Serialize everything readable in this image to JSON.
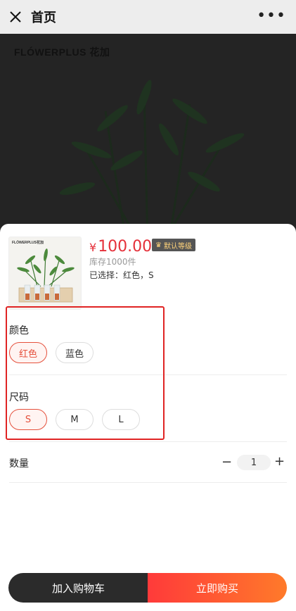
{
  "header": {
    "title": "首页",
    "more": "•••"
  },
  "hero": {
    "brand": "FLÓWERPLUS 花加"
  },
  "product": {
    "thumb_brand": "FLÓWERPLUS花加",
    "currency": "¥",
    "price": "100.00",
    "badge": "默认等级",
    "stock": "库存1000件",
    "selected": "已选择：红色，S"
  },
  "options": {
    "color": {
      "title": "颜色",
      "items": [
        "红色",
        "蓝色"
      ],
      "active": "红色"
    },
    "size": {
      "title": "尺码",
      "items": [
        "S",
        "M",
        "L"
      ],
      "active": "S"
    }
  },
  "quantity": {
    "label": "数量",
    "value": "1",
    "minus": "−",
    "plus": "+"
  },
  "actions": {
    "cart": "加入购物车",
    "buy": "立即购买"
  },
  "colors": {
    "accent": "#e5303a",
    "highlight": "#e02424",
    "buy_start": "#ff3a3a",
    "buy_end": "#ff7a2a",
    "cart": "#2b2b2b"
  }
}
